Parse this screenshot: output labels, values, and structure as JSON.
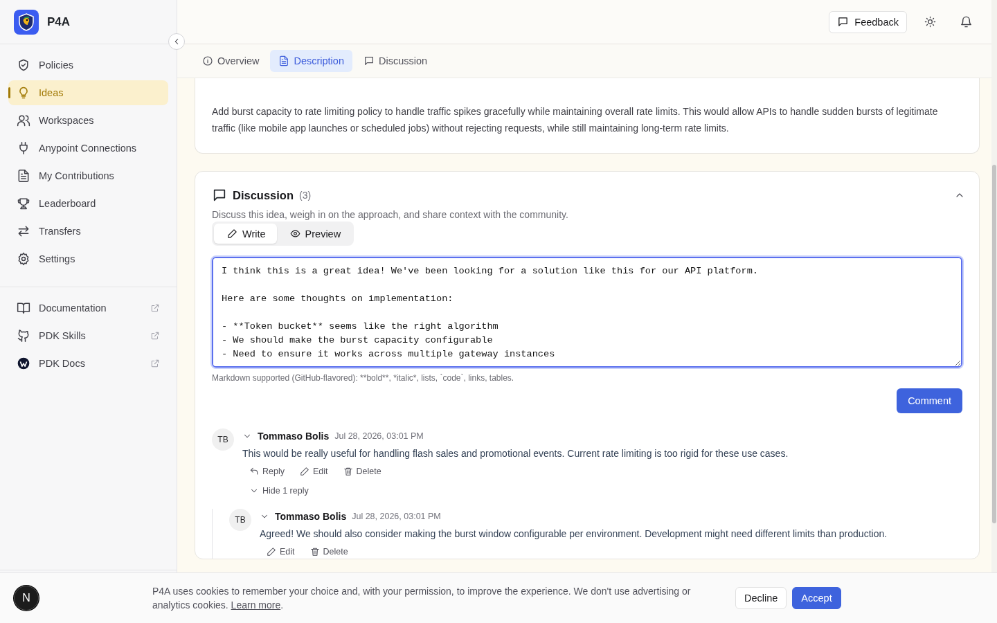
{
  "brand": {
    "name": "P4A"
  },
  "sidebar": {
    "nav": [
      {
        "label": "Policies",
        "selected": false
      },
      {
        "label": "Ideas",
        "selected": true
      },
      {
        "label": "Workspaces",
        "selected": false
      },
      {
        "label": "Anypoint Connections",
        "selected": false
      },
      {
        "label": "My Contributions",
        "selected": false
      },
      {
        "label": "Leaderboard",
        "selected": false
      },
      {
        "label": "Transfers",
        "selected": false
      },
      {
        "label": "Settings",
        "selected": false
      }
    ],
    "links": [
      {
        "label": "Documentation"
      },
      {
        "label": "PDK Skills"
      },
      {
        "label": "PDK Docs"
      }
    ]
  },
  "header": {
    "feedback": "Feedback"
  },
  "tabs": [
    {
      "label": "Overview",
      "selected": false
    },
    {
      "label": "Description",
      "selected": true
    },
    {
      "label": "Discussion",
      "selected": false
    }
  ],
  "description": {
    "text": "Add burst capacity to rate limiting policy to handle traffic spikes gracefully while maintaining overall rate limits. This would allow APIs to handle sudden bursts of legitimate traffic (like mobile app launches or scheduled jobs) without rejecting requests, while still maintaining long-term rate limits."
  },
  "discussion": {
    "title": "Discussion",
    "count": "(3)",
    "subtitle": "Discuss this idea, weigh in on the approach, and share context with the community.",
    "editor_tabs": [
      {
        "label": "Write",
        "selected": true
      },
      {
        "label": "Preview",
        "selected": false
      }
    ],
    "value": "I think this is a great idea! We've been looking for a solution like this for our API platform.\n\nHere are some thoughts on implementation:\n\n- **Token bucket** seems like the right algorithm\n- We should make the burst capacity configurable\n- Need to ensure it works across multiple gateway instances",
    "hint": "Markdown supported (GitHub-flavored): **bold**, *italic*, lists, `code`, links, tables.",
    "submit": "Comment",
    "comments": [
      {
        "initials": "TB",
        "author": "Tommaso Bolis",
        "date": "Jul 28, 2026, 03:01 PM",
        "text": "This would be really useful for handling flash sales and promotional events. Current rate limiting is too rigid for these use cases.",
        "actions": [
          {
            "kind": "reply",
            "label": "Reply"
          },
          {
            "kind": "edit",
            "label": "Edit"
          },
          {
            "kind": "delete",
            "label": "Delete"
          }
        ],
        "replies_toggle": "Hide 1 reply",
        "replies": [
          {
            "initials": "TB",
            "author": "Tommaso Bolis",
            "date": "Jul 28, 2026, 03:01 PM",
            "text": "Agreed! We should also consider making the burst window configurable per environment. Development might need different limits than production.",
            "actions": [
              {
                "kind": "edit",
                "label": "Edit"
              },
              {
                "kind": "delete",
                "label": "Delete"
              }
            ]
          }
        ]
      }
    ]
  },
  "cookie": {
    "text": "P4A uses cookies to remember your choice and, with your permission, to improve the experience. We don't use advertising or analytics cookies.",
    "link": "Learn more",
    "end": ".",
    "buttons": [
      {
        "label": "Decline",
        "kind": "secondary"
      },
      {
        "label": "Accept",
        "kind": "primary"
      }
    ]
  },
  "dev_badge": "N"
}
